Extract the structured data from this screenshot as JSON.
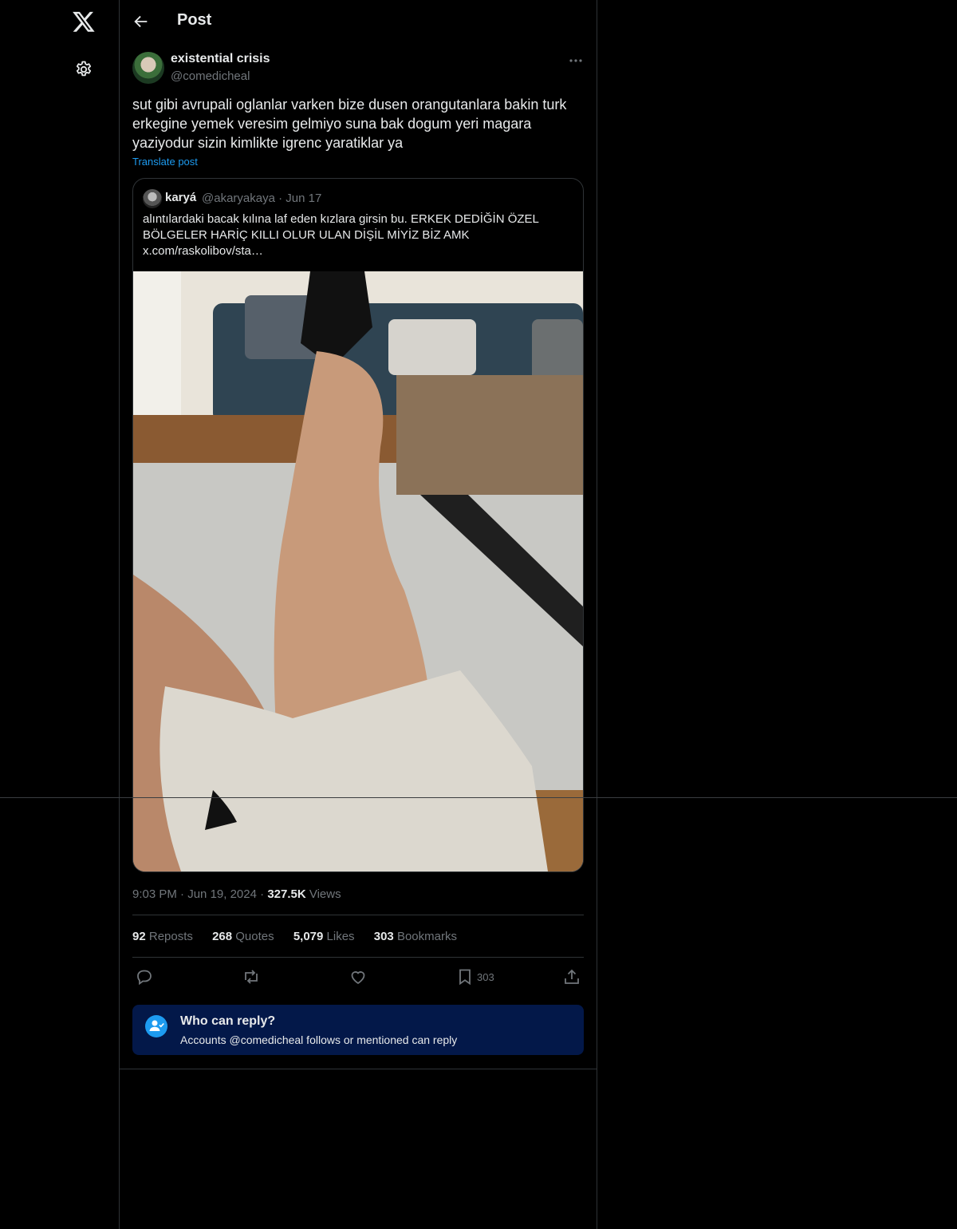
{
  "header": {
    "title": "Post"
  },
  "post": {
    "display_name": "existential crisis",
    "handle": "@comedicheal",
    "text": "sut gibi avrupali oglanlar varken bize dusen orangutanlara bakin turk erkegine yemek veresim gelmiyo suna bak dogum yeri magara yaziyodur sizin kimlikte igrenc yaratiklar ya",
    "translate_label": "Translate post",
    "time": "9:03 PM",
    "date": "Jun 19, 2024",
    "views_count": "327.5K",
    "views_label": "Views"
  },
  "quote": {
    "display_name": "karyá",
    "handle": "@akaryakaya",
    "date": "Jun 17",
    "text": "alıntılardaki bacak kılına laf eden kızlara girsin bu. ERKEK DEDİĞİN ÖZEL BÖLGELER HARİÇ KILLI OLUR ULAN DİŞİL MİYİZ BİZ AMK x.com/raskolibov/sta…"
  },
  "stats": {
    "reposts_count": "92",
    "reposts_label": "Reposts",
    "quotes_count": "268",
    "quotes_label": "Quotes",
    "likes_count": "5,079",
    "likes_label": "Likes",
    "bookmarks_count": "303",
    "bookmarks_label": "Bookmarks"
  },
  "actions": {
    "bookmark_count": "303"
  },
  "reply_settings": {
    "title": "Who can reply?",
    "subtitle": "Accounts @comedicheal follows or mentioned can reply"
  },
  "colors": {
    "accent": "#1d9bf0",
    "background": "#000000",
    "muted": "#71767b",
    "reply_box": "#031849"
  },
  "icons": [
    "x-logo-icon",
    "gear-icon",
    "back-arrow-icon",
    "more-icon",
    "reply-icon",
    "repost-icon",
    "like-icon",
    "bookmark-icon",
    "share-icon",
    "person-check-icon"
  ]
}
